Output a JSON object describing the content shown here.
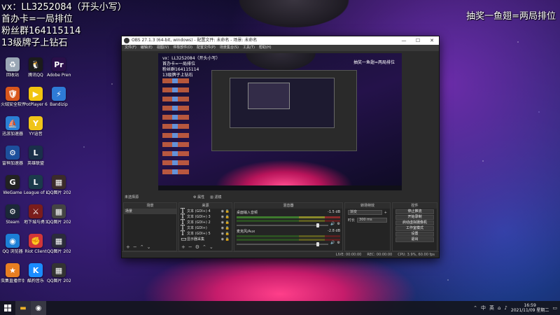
{
  "overlay": {
    "line1": "vx：LL3252084（开头小写）",
    "line2": "首办卡=一局排位",
    "line3": "粉丝群164115114",
    "line4": "13级牌子上钻石",
    "right": "抽奖一鱼翅=两局排位"
  },
  "desktop_icons": [
    {
      "label": "回收站",
      "icon": "recycle-bin-icon",
      "color": "#9aa7b5",
      "glyph": "♻"
    },
    {
      "label": "腾讯QQ",
      "icon": "qq-icon",
      "color": "#1b1b1b",
      "glyph": "🐧"
    },
    {
      "label": "Adobe Premie...",
      "icon": "premiere-icon",
      "color": "#2a0f4a",
      "glyph": "Pr"
    },
    {
      "label": "火绒安全软件",
      "icon": "huorong-icon",
      "color": "#d8561c",
      "glyph": "🛡"
    },
    {
      "label": "PotPlayer 64 bit",
      "icon": "potplayer-icon",
      "color": "#f1c40f",
      "glyph": "▶"
    },
    {
      "label": "Bandizip",
      "icon": "bandizip-icon",
      "color": "#2e7bd6",
      "glyph": "⚡"
    },
    {
      "label": "迅游加速器",
      "icon": "xunyou-icon",
      "color": "#2a7fd4",
      "glyph": "⛵"
    },
    {
      "label": "YY语音",
      "icon": "yy-icon",
      "color": "#f0c419",
      "glyph": "Y"
    },
    {
      "label": "",
      "icon": "blank-icon",
      "color": "transparent",
      "glyph": ""
    },
    {
      "label": "雷神加速器",
      "icon": "leishen-icon",
      "color": "#1d4f9c",
      "glyph": "⚙"
    },
    {
      "label": "英雄联盟",
      "icon": "lol-cn-icon",
      "color": "#1a2f4a",
      "glyph": "L"
    },
    {
      "label": "",
      "icon": "blank-icon",
      "color": "transparent",
      "glyph": ""
    },
    {
      "label": "WeGame",
      "icon": "wegame-icon",
      "color": "#222",
      "glyph": "G"
    },
    {
      "label": "League of Legends",
      "icon": "lol-icon",
      "color": "#1b3a4b",
      "glyph": "L"
    },
    {
      "label": "QQ图片 2021110...",
      "icon": "image-file-icon",
      "color": "#3b2b2b",
      "glyph": "▦"
    },
    {
      "label": "Steam",
      "icon": "steam-icon",
      "color": "#1b2838",
      "glyph": "⚙"
    },
    {
      "label": "地下城与勇士",
      "icon": "dnf-icon",
      "color": "#7a1c1c",
      "glyph": "⚔"
    },
    {
      "label": "QQ图片 2021110...",
      "icon": "image-file-icon",
      "color": "#444",
      "glyph": "▦"
    },
    {
      "label": "QQ 浏览器",
      "icon": "qq-browser-icon",
      "color": "#1c7fd6",
      "glyph": "◉"
    },
    {
      "label": "Riot Client",
      "icon": "riot-icon",
      "color": "#d13639",
      "glyph": "✊"
    },
    {
      "label": "QQ图片 2021110...",
      "icon": "image-file-icon",
      "color": "#2b2b3b",
      "glyph": "▦"
    },
    {
      "label": "虫集直播伴侣",
      "icon": "live-companion-icon",
      "color": "#e67e22",
      "glyph": "★"
    },
    {
      "label": "酷狗音乐",
      "icon": "kugou-icon",
      "color": "#1a8cff",
      "glyph": "K"
    },
    {
      "label": "QQ图片 2021110...",
      "icon": "image-file-icon",
      "color": "#333",
      "glyph": "▦"
    }
  ],
  "obs": {
    "title": "OBS 27.1.3 (64-bit, windows) - 配置文件: 未命名 - 场景: 未命名",
    "menu": [
      "文件(F)",
      "编辑(E)",
      "视图(V)",
      "停靠部件(D)",
      "配置文件(P)",
      "场景集合(S)",
      "工具(T)",
      "帮助(H)"
    ],
    "preview_overlay": [
      "vx：LL3252084（开头小写）",
      "首办卡=一局排位",
      "粉丝群164115114",
      "13级牌子上钻石"
    ],
    "preview_overlay_right": "抽奖一鱼翅=两局排位",
    "strip": [
      "未选择源",
      "⚙ 属性",
      "▥ 滤镜"
    ],
    "scenes_header": "场景",
    "scene_item": "场景",
    "sources_header": "来源",
    "sources": [
      {
        "name": "文本 (GDI+) 4",
        "type": "text"
      },
      {
        "name": "文本 (GDI+) 3",
        "type": "text"
      },
      {
        "name": "文本 (GDI+) 2",
        "type": "text"
      },
      {
        "name": "文本 (GDI+)",
        "type": "text"
      },
      {
        "name": "文本 (GDI+) 5",
        "type": "text"
      },
      {
        "name": "显示器采集",
        "type": "display"
      }
    ],
    "mixer_header": "混音器",
    "mixer": [
      {
        "name": "桌面输入音频",
        "db": "-1.5 dB"
      },
      {
        "name": "麦克风/Aux",
        "db": "-2.8 dB"
      }
    ],
    "transitions_header": "转场特效",
    "transition": "渐变",
    "duration_label": "时长",
    "duration_value": "300 ms",
    "controls_header": "控件",
    "controls": [
      "停止推流",
      "开始录制",
      "启动虚拟摄像机",
      "工作室模式",
      "设置",
      "退出"
    ],
    "status": [
      "LIVE: 00:00:00",
      "REC: 00:00:00",
      "CPU: 3.9%, 60.00 fps"
    ]
  },
  "taskbar": {
    "tray_text": [
      "中",
      "英"
    ],
    "time": "16:59",
    "date": "2021/11/09 星期二"
  }
}
